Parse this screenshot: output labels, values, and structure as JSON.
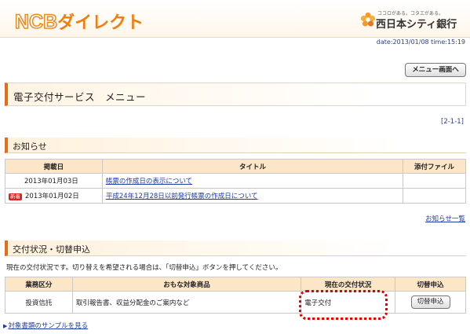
{
  "header": {
    "logo_ncb": "NCB",
    "logo_direct": "ダイレクト",
    "bank_tagline": "ココロがある。コタエがある。",
    "bank_name": "西日本シティ銀行"
  },
  "datetime": "date:2013/01/08 time:15:19",
  "menu_button": "メニュー画面へ",
  "page_title": "電子交付サービス　メニュー",
  "page_code": "[2-1-1]",
  "news": {
    "heading": "お知らせ",
    "columns": [
      "掲載日",
      "タイトル",
      "添付ファイル"
    ],
    "rows": [
      {
        "new": "",
        "date": "2013年01月03日",
        "title": "帳票の作成日の表示について",
        "attachment": ""
      },
      {
        "new": "新着",
        "date": "2013年01月02日",
        "title": "平成24年12月28日以前発行帳票の作成日について",
        "attachment": ""
      }
    ],
    "more_link": "お知らせ一覧"
  },
  "status": {
    "heading": "交付状況・切替申込",
    "note": "現在の交付状況です。切り替えを希望される場合は、「切替申込」ボタンを押してください。",
    "columns": [
      "業務区分",
      "おもな対象商品",
      "現在の交付状況",
      "切替申込"
    ],
    "rows": [
      {
        "category": "投資信託",
        "products": "取引報告書、収益分配金のご案内など",
        "current": "電子交付",
        "button": "切替申込"
      }
    ]
  },
  "sample_link": "対象書類のサンプルを見る",
  "colors": {
    "accent": "#e36e1a",
    "link": "#1b3aa5",
    "header_fill": "#fde6c8",
    "highlight": "#e00000"
  }
}
